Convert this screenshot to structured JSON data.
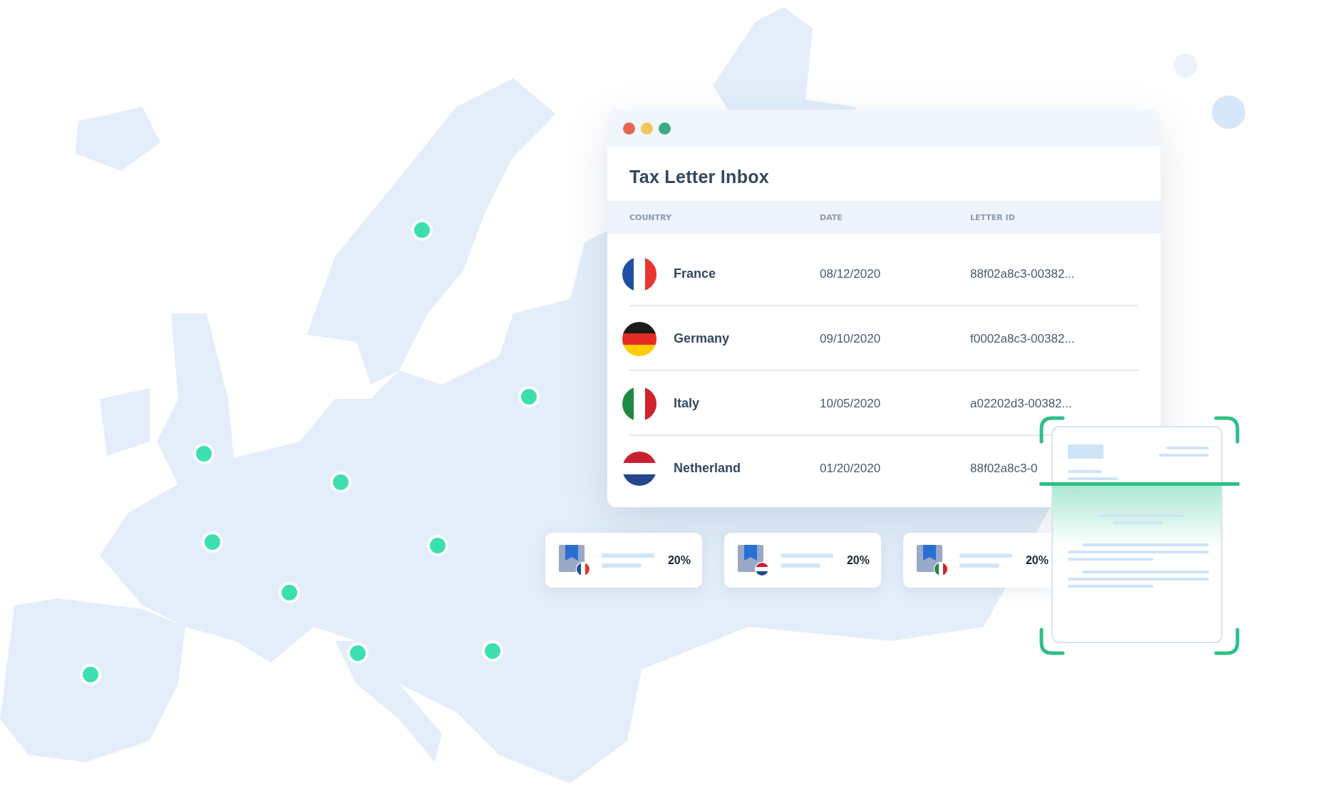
{
  "window": {
    "title": "Tax Letter Inbox"
  },
  "table": {
    "columns": [
      "COUNTRY",
      "DATE",
      "LETTER ID"
    ],
    "rows": [
      {
        "kind": "fr",
        "country": "France",
        "date": "08/12/2020",
        "letter_id": "88f02a8c3-00382..."
      },
      {
        "kind": "de",
        "country": "Germany",
        "date": "09/10/2020",
        "letter_id": "f0002a8c3-00382..."
      },
      {
        "kind": "it",
        "country": "Italy",
        "date": "10/05/2020",
        "letter_id": "a02202d3-00382..."
      },
      {
        "kind": "nl",
        "country": "Netherland",
        "date": "01/20/2020",
        "letter_id": "88f02a8c3-0"
      }
    ]
  },
  "cards": [
    {
      "kind": "fr",
      "percent": "20%"
    },
    {
      "kind": "nl",
      "percent": "20%"
    },
    {
      "kind": "it",
      "percent": "20%"
    }
  ]
}
